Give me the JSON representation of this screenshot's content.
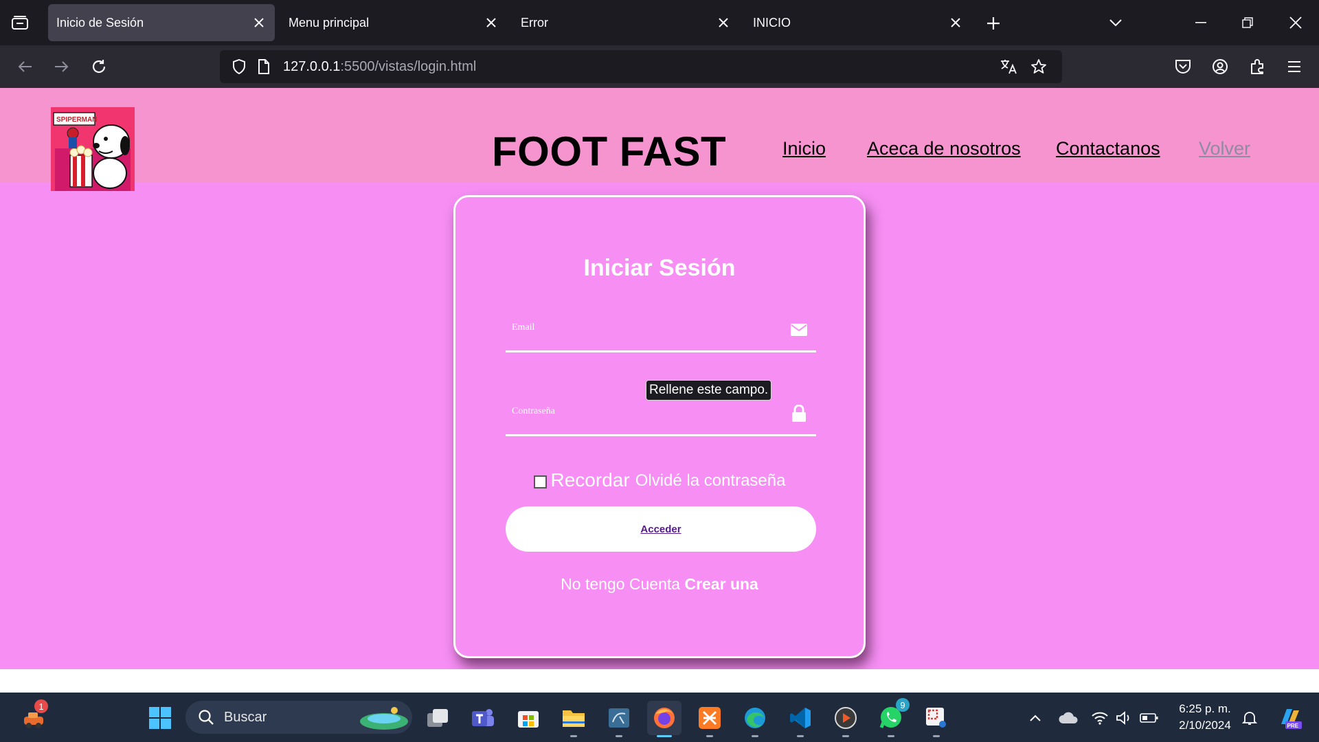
{
  "browser": {
    "tabs": [
      {
        "label": "Inicio de Sesión",
        "active": true
      },
      {
        "label": "Menu principal",
        "active": false
      },
      {
        "label": "Error",
        "active": false
      },
      {
        "label": "INICIO",
        "active": false
      }
    ],
    "url_host": "127.0.0.1",
    "url_path": ":5500/vistas/login.html"
  },
  "site": {
    "logo_text": "SPIPERMAN",
    "title": "FOOT FAST",
    "nav": [
      "Inicio",
      "Aceca de nosotros",
      "Contactanos",
      "Volver"
    ]
  },
  "login": {
    "title": "Iniciar Sesión",
    "email_placeholder": "Email",
    "password_placeholder": "Contraseña",
    "tooltip": "Rellene este campo.",
    "remember_label": "Recordar",
    "forgot_label": "Olvidé la contraseña",
    "submit_label": "Acceder",
    "no_account_text": "No tengo Cuenta",
    "create_link": "Crear una"
  },
  "taskbar": {
    "search_placeholder": "Buscar",
    "time": "6:25 p. m.",
    "date": "2/10/2024",
    "notification_badge": "1",
    "whatsapp_badge": "9",
    "copilot_label": "PRE"
  },
  "colors": {
    "page_bg": "#f68ef4",
    "header_bg": "#f694d0",
    "nav_muted": "#8d8ca3",
    "button_link": "#551a8b"
  }
}
